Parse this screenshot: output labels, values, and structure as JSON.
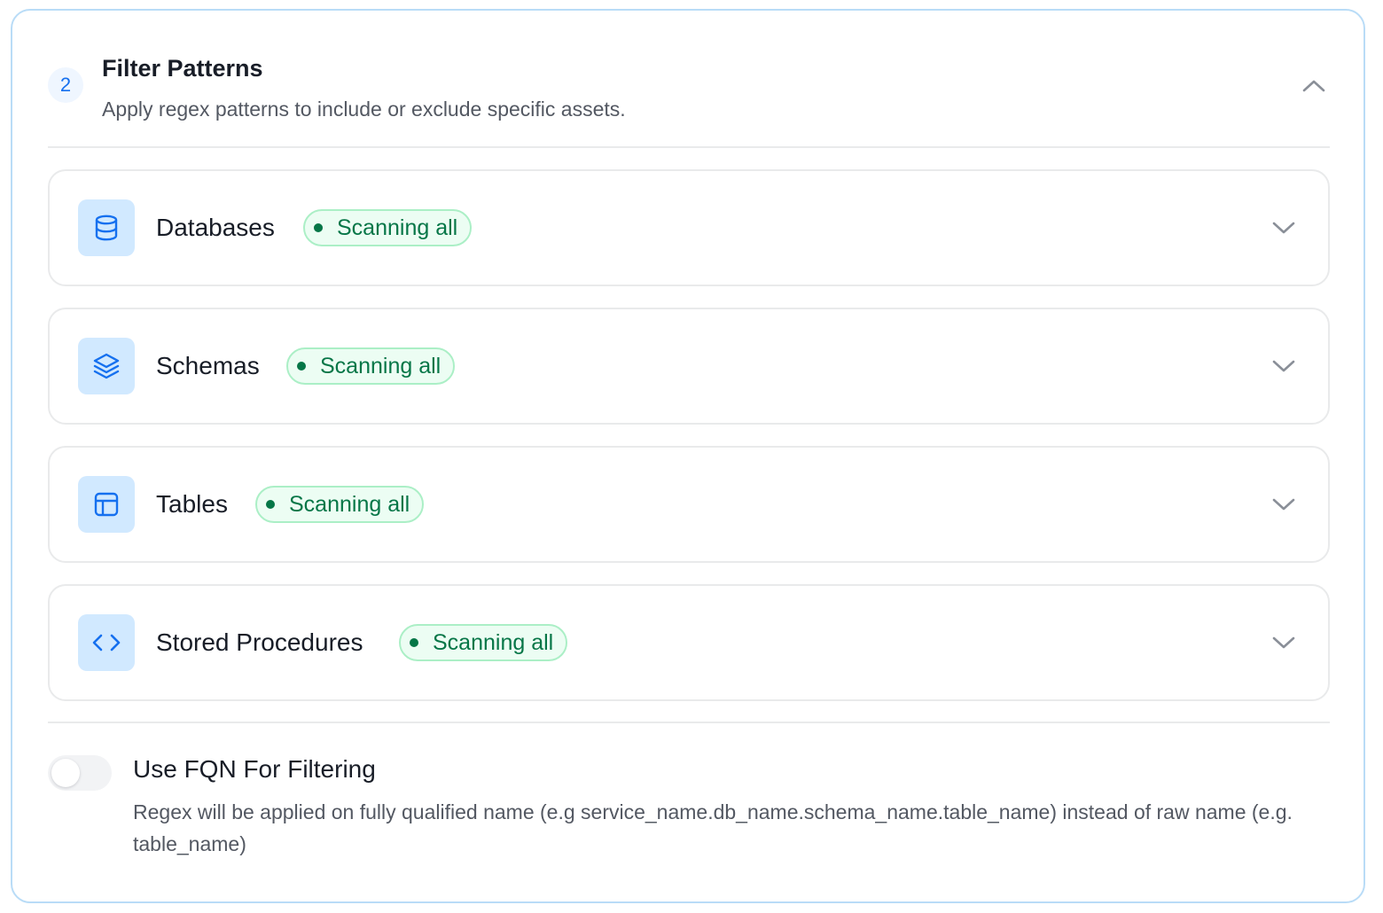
{
  "section": {
    "step_number": "2",
    "title": "Filter Patterns",
    "subtitle": "Apply regex patterns to include or exclude specific assets.",
    "collapse_icon": "chevron-up-icon"
  },
  "filters": [
    {
      "label": "Databases",
      "icon": "database-icon",
      "status": "Scanning all"
    },
    {
      "label": "Schemas",
      "icon": "layers-icon",
      "status": "Scanning all"
    },
    {
      "label": "Tables",
      "icon": "table-icon",
      "status": "Scanning all"
    },
    {
      "label": "Stored Procedures",
      "icon": "code-icon",
      "status": "Scanning all"
    }
  ],
  "fqn": {
    "title": "Use FQN For Filtering",
    "description": "Regex will be applied on fully qualified name (e.g service_name.db_name.schema_name.table_name) instead of raw name (e.g. table_name)",
    "enabled": false
  },
  "colors": {
    "accent": "#1570ef",
    "icon_bg": "#d1e9ff",
    "status_text": "#067647",
    "status_bg": "#ecfdf3",
    "status_border": "#abefc6",
    "panel_border": "#b9dcf7"
  }
}
